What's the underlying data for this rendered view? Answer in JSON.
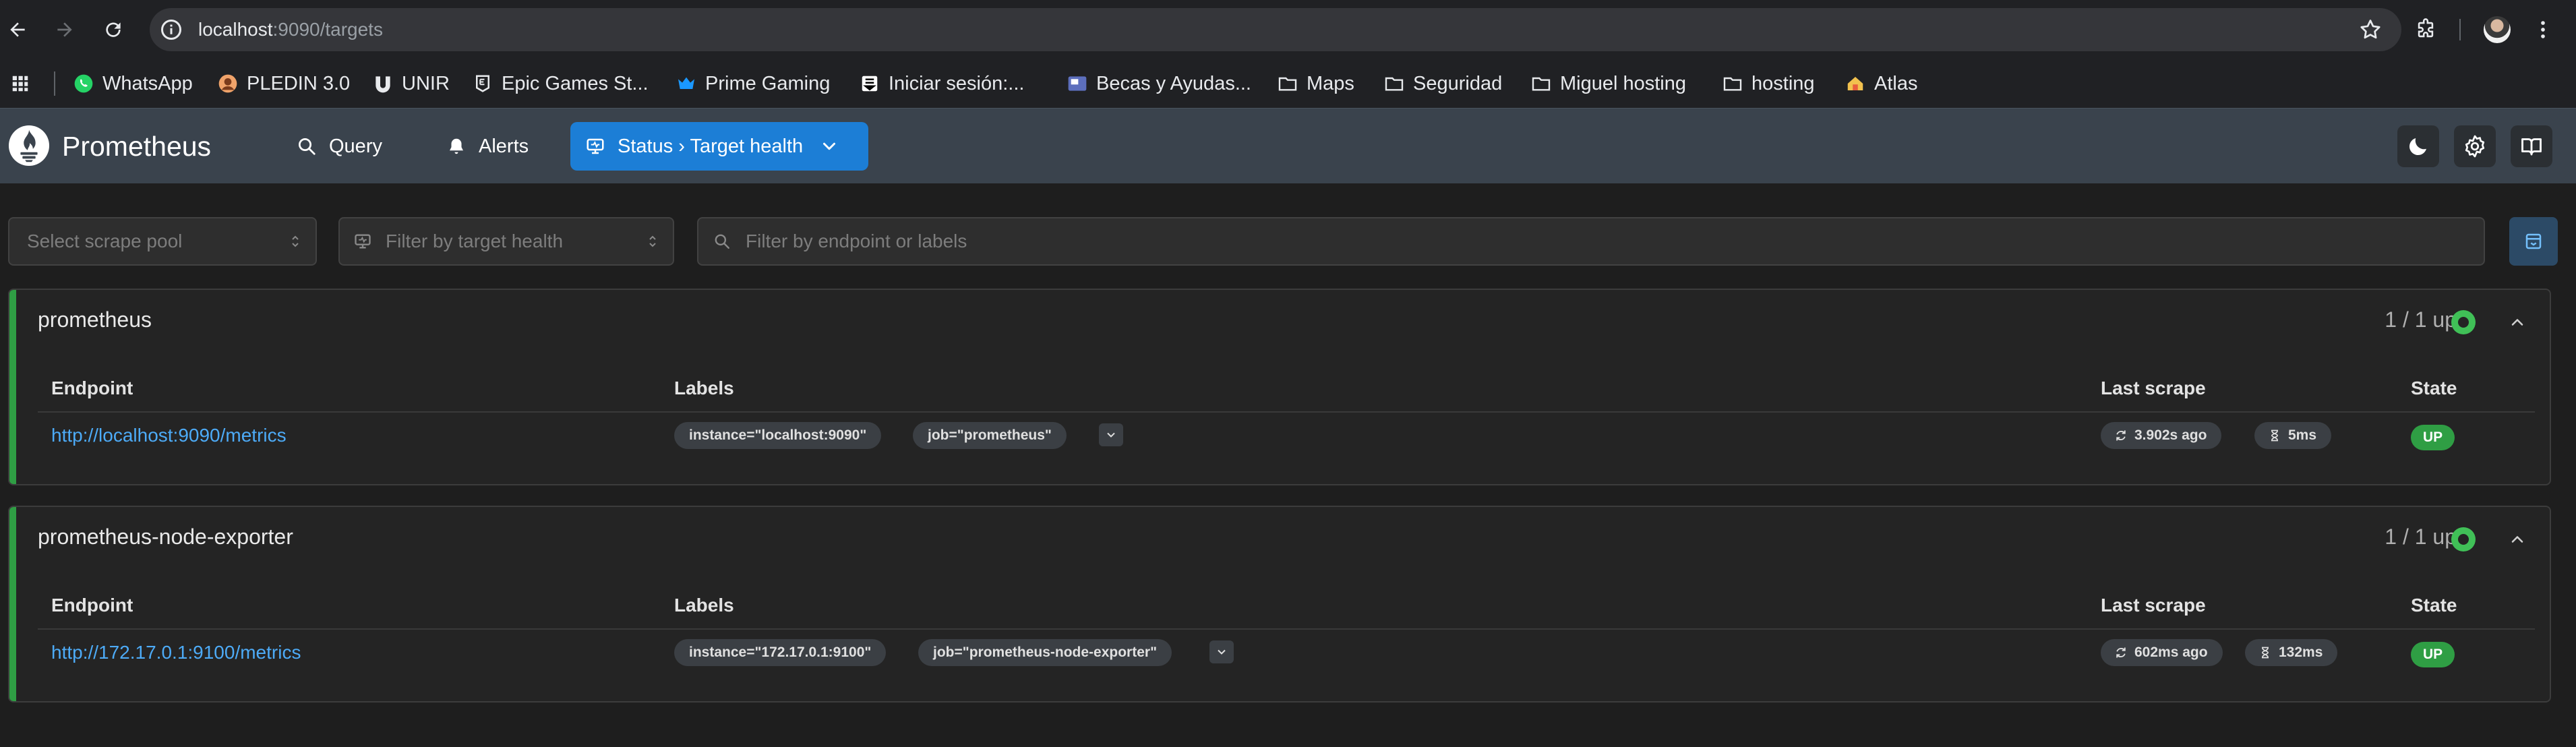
{
  "browser": {
    "url_host": "localhost",
    "url_path": ":9090/targets",
    "bookmarks": [
      {
        "label": "WhatsApp",
        "icon": "whatsapp-icon"
      },
      {
        "label": "PLEDIN 3.0",
        "icon": "pledin-icon"
      },
      {
        "label": "UNIR",
        "icon": "unir-icon"
      },
      {
        "label": "Epic Games St...",
        "icon": "epic-games-icon"
      },
      {
        "label": "Prime Gaming",
        "icon": "crown-icon"
      },
      {
        "label": "Iniciar sesión:...",
        "icon": "substack-icon"
      },
      {
        "label": "Becas y Ayudas...",
        "icon": "becas-icon"
      },
      {
        "label": "Maps",
        "icon": "folder-icon"
      },
      {
        "label": "Seguridad",
        "icon": "folder-icon"
      },
      {
        "label": "Miguel hosting",
        "icon": "folder-icon"
      },
      {
        "label": "hosting",
        "icon": "folder-icon"
      },
      {
        "label": "Atlas",
        "icon": "atlas-icon"
      }
    ]
  },
  "header": {
    "brand": "Prometheus",
    "nav": {
      "query": "Query",
      "alerts": "Alerts",
      "status": "Status › Target health"
    }
  },
  "filters": {
    "scrape_pool_placeholder": "Select scrape pool",
    "health_placeholder": "Filter by target health",
    "search_placeholder": "Filter by endpoint or labels"
  },
  "columns": {
    "endpoint": "Endpoint",
    "labels": "Labels",
    "last_scrape": "Last scrape",
    "state": "State"
  },
  "pools": [
    {
      "name": "prometheus",
      "count": "1 / 1 up",
      "targets": [
        {
          "endpoint": "http://localhost:9090/metrics",
          "labels": [
            "instance=\"localhost:9090\"",
            "job=\"prometheus\""
          ],
          "last_scrape": "3.902s ago",
          "duration": "5ms",
          "state": "UP"
        }
      ]
    },
    {
      "name": "prometheus-node-exporter",
      "count": "1 / 1 up",
      "targets": [
        {
          "endpoint": "http://172.17.0.1:9100/metrics",
          "labels": [
            "instance=\"172.17.0.1:9100\"",
            "job=\"prometheus-node-exporter\""
          ],
          "last_scrape": "602ms ago",
          "duration": "132ms",
          "state": "UP"
        }
      ]
    }
  ],
  "colors": {
    "accent": "#1c7ed6",
    "health_up": "#2f9e44",
    "link": "#4dabf7",
    "header_bg": "#3a434d"
  }
}
